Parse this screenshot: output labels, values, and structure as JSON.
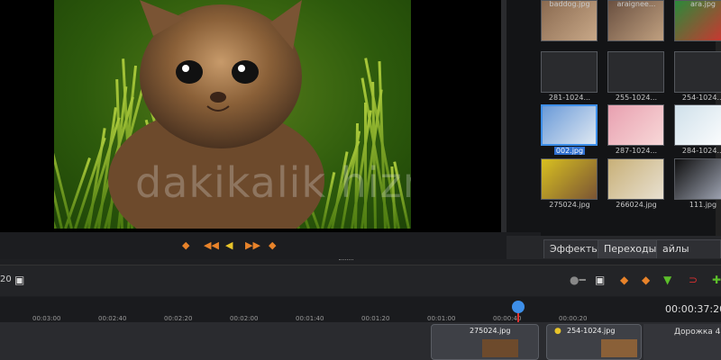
{
  "preview": {
    "watermark": "dakikalik hizmetleri"
  },
  "browser": {
    "items": [
      {
        "label": "",
        "kind": "puppy"
      },
      {
        "label": "",
        "kind": "kitten-knit"
      },
      {
        "label": "",
        "kind": "tabby"
      },
      {
        "label": "281-1024...",
        "kind": "blank"
      },
      {
        "label": "255-1024...",
        "kind": "blank"
      },
      {
        "label": "254-1024...",
        "kind": "blank"
      },
      {
        "label": "002.jpg",
        "kind": "winter",
        "selected": true
      },
      {
        "label": "287-1024...",
        "kind": "pink"
      },
      {
        "label": "284-1024...",
        "kind": "polar"
      },
      {
        "label": "275024.jpg",
        "kind": "kitten"
      },
      {
        "label": "266024.jpg",
        "kind": "cats"
      },
      {
        "label": "111.jpg",
        "kind": "blackcat"
      },
      {
        "label": "baddog.jpg",
        "kind": "dog"
      },
      {
        "label": "araignee...",
        "kind": "spider"
      },
      {
        "label": "ara.jpg",
        "kind": "parrot"
      }
    ]
  },
  "tabs": {
    "project": "айлы проекта",
    "transitions": "Переходы",
    "effects": "Эффекты"
  },
  "toolbar": {
    "left_num": "20"
  },
  "timeline": {
    "current_time": "00:00:37:20",
    "ticks": [
      "00:03:00",
      "00:02:40",
      "00:02:20",
      "00:02:00",
      "00:01:40",
      "00:01:20",
      "00:01:00",
      "00:00:40",
      "00:00:20"
    ],
    "track_name": "Дорожка 4",
    "clips": [
      {
        "title": "254-1024.jpg"
      },
      {
        "title": "275024.jpg"
      }
    ]
  },
  "colors": {
    "accent": "#3d8ee8",
    "orange": "#e8832a",
    "green": "#5cbf2a",
    "red": "#d83030"
  }
}
